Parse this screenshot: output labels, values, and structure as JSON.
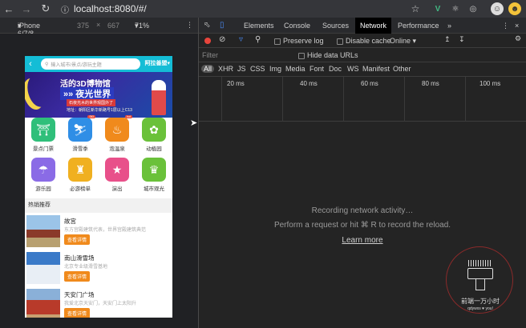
{
  "browser": {
    "url": "localhost:8080/#/",
    "back_icon": "back-arrow-icon",
    "forward_icon": "forward-arrow-icon",
    "reload_icon": "reload-icon"
  },
  "device_toolbar": {
    "device": "iPhone 6/7/8",
    "width": "375",
    "height": "667",
    "zoom": "71%"
  },
  "phone": {
    "search_placeholder": "输入城市/景点/游玩主题",
    "city": "阿拉善盟",
    "banner": {
      "line1": "活的3D博物馆",
      "line2": "夜光世界",
      "line3": "石夜光木的世界观国外了",
      "line4": "地址：朝阳区新华新路号1层以上C13"
    },
    "grid": [
      {
        "label": "景点门票",
        "color": "#2fbf7a",
        "badge": ""
      },
      {
        "label": "滑雪季",
        "color": "#2f8ee6",
        "badge": "SKI"
      },
      {
        "label": "泡温泉",
        "color": "#f08a1c",
        "badge": "hot"
      },
      {
        "label": "动植园",
        "color": "#6ac13a",
        "badge": ""
      },
      {
        "label": "游乐园",
        "color": "#8a6be6",
        "badge": ""
      },
      {
        "label": "必游榜单",
        "color": "#f0b020",
        "badge": ""
      },
      {
        "label": "演出",
        "color": "#e8508a",
        "badge": ""
      },
      {
        "label": "城市观光",
        "color": "#6ac13a",
        "badge": ""
      }
    ],
    "hot_title": "热销推荐",
    "items": [
      {
        "title": "故宫",
        "desc": "东方宫殿建筑代表，世界宫殿建筑典范",
        "button": "查看详情"
      },
      {
        "title": "南山滑雪场",
        "desc": "北京专业级滑雪基地",
        "button": "查看详情"
      },
      {
        "title": "天安门广场",
        "desc": "我爱北京天安门，天安门上太阳升",
        "button": "查看详情"
      }
    ]
  },
  "devtools": {
    "tabs": [
      "Elements",
      "Console",
      "Sources",
      "Network",
      "Performance"
    ],
    "active_tab": "Network",
    "more": "»",
    "preserve_log": "Preserve log",
    "disable_cache": "Disable cache",
    "throttle": "Online",
    "filter_placeholder": "Filter",
    "hide_data_urls": "Hide data URLs",
    "types": [
      "All",
      "XHR",
      "JS",
      "CSS",
      "Img",
      "Media",
      "Font",
      "Doc",
      "WS",
      "Manifest",
      "Other"
    ],
    "timeline": [
      "20 ms",
      "40 ms",
      "60 ms",
      "80 ms",
      "100 ms"
    ],
    "recording": "Recording network activity…",
    "perform": "Perform a request or hit ⌘ R to record the reload.",
    "learn_more": "Learn more"
  },
  "watermark": {
    "line1": "前端一万小时",
    "line2": "qdywxs ♥ you!"
  }
}
